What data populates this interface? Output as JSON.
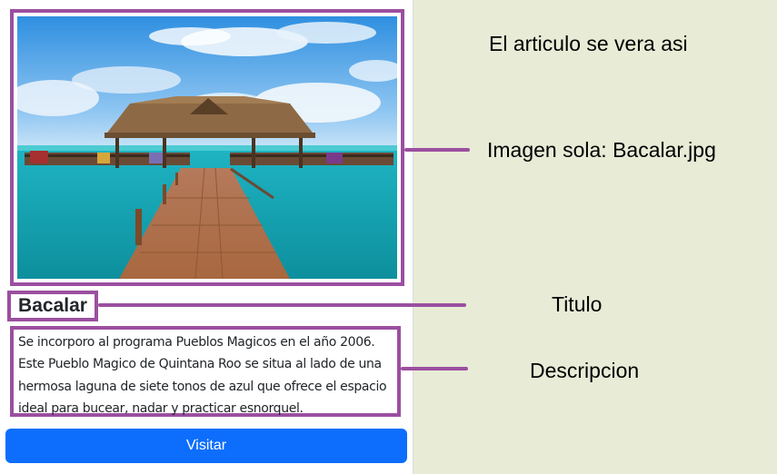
{
  "article": {
    "image_alt": "Bacalar",
    "title": "Bacalar",
    "description": "Se incorporo al programa Pueblos Magicos en el año 2006. Este Pueblo Magico de Quintana Roo se situa al lado de una hermosa laguna de siete tonos de azul que ofrece el espacio ideal para bucear, nadar y practicar esnorquel.",
    "button_label": "Visitar"
  },
  "annotations": {
    "heading": "El articulo se vera asi",
    "image_label": "Imagen sola: Bacalar.jpg",
    "title_label": "Titulo",
    "description_label": "Descripcion"
  },
  "colors": {
    "annotation_border": "#9b4fa0",
    "button_bg": "#0d6efd",
    "background": "#e8ebd6"
  }
}
